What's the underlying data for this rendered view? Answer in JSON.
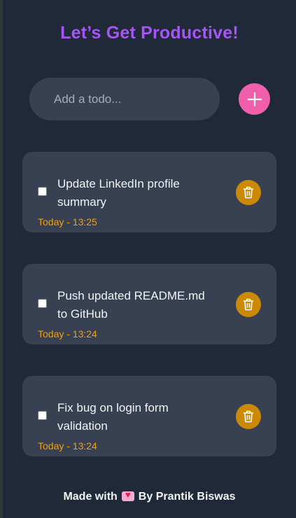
{
  "header": {
    "title": "Let’s Get Productive!"
  },
  "input": {
    "placeholder": "Add a todo...",
    "value": ""
  },
  "add_button": {
    "icon": "plus-icon"
  },
  "todos": [
    {
      "text": "Update LinkedIn profile summary",
      "time": "Today - 13:25",
      "checked": false
    },
    {
      "text": "Push updated README.md to GitHub",
      "time": "Today - 13:24",
      "checked": false
    },
    {
      "text": "Fix bug on login form validation",
      "time": "Today - 13:24",
      "checked": false
    }
  ],
  "footer": {
    "prefix": "Made with",
    "suffix": "By Prantik Biswas",
    "icon": "heart-icon"
  },
  "colors": {
    "background": "#1f2937",
    "card": "#374151",
    "title": "#a855f7",
    "add_button": "#f05fab",
    "delete_button": "#ca8a04",
    "time": "#f59e0b"
  }
}
